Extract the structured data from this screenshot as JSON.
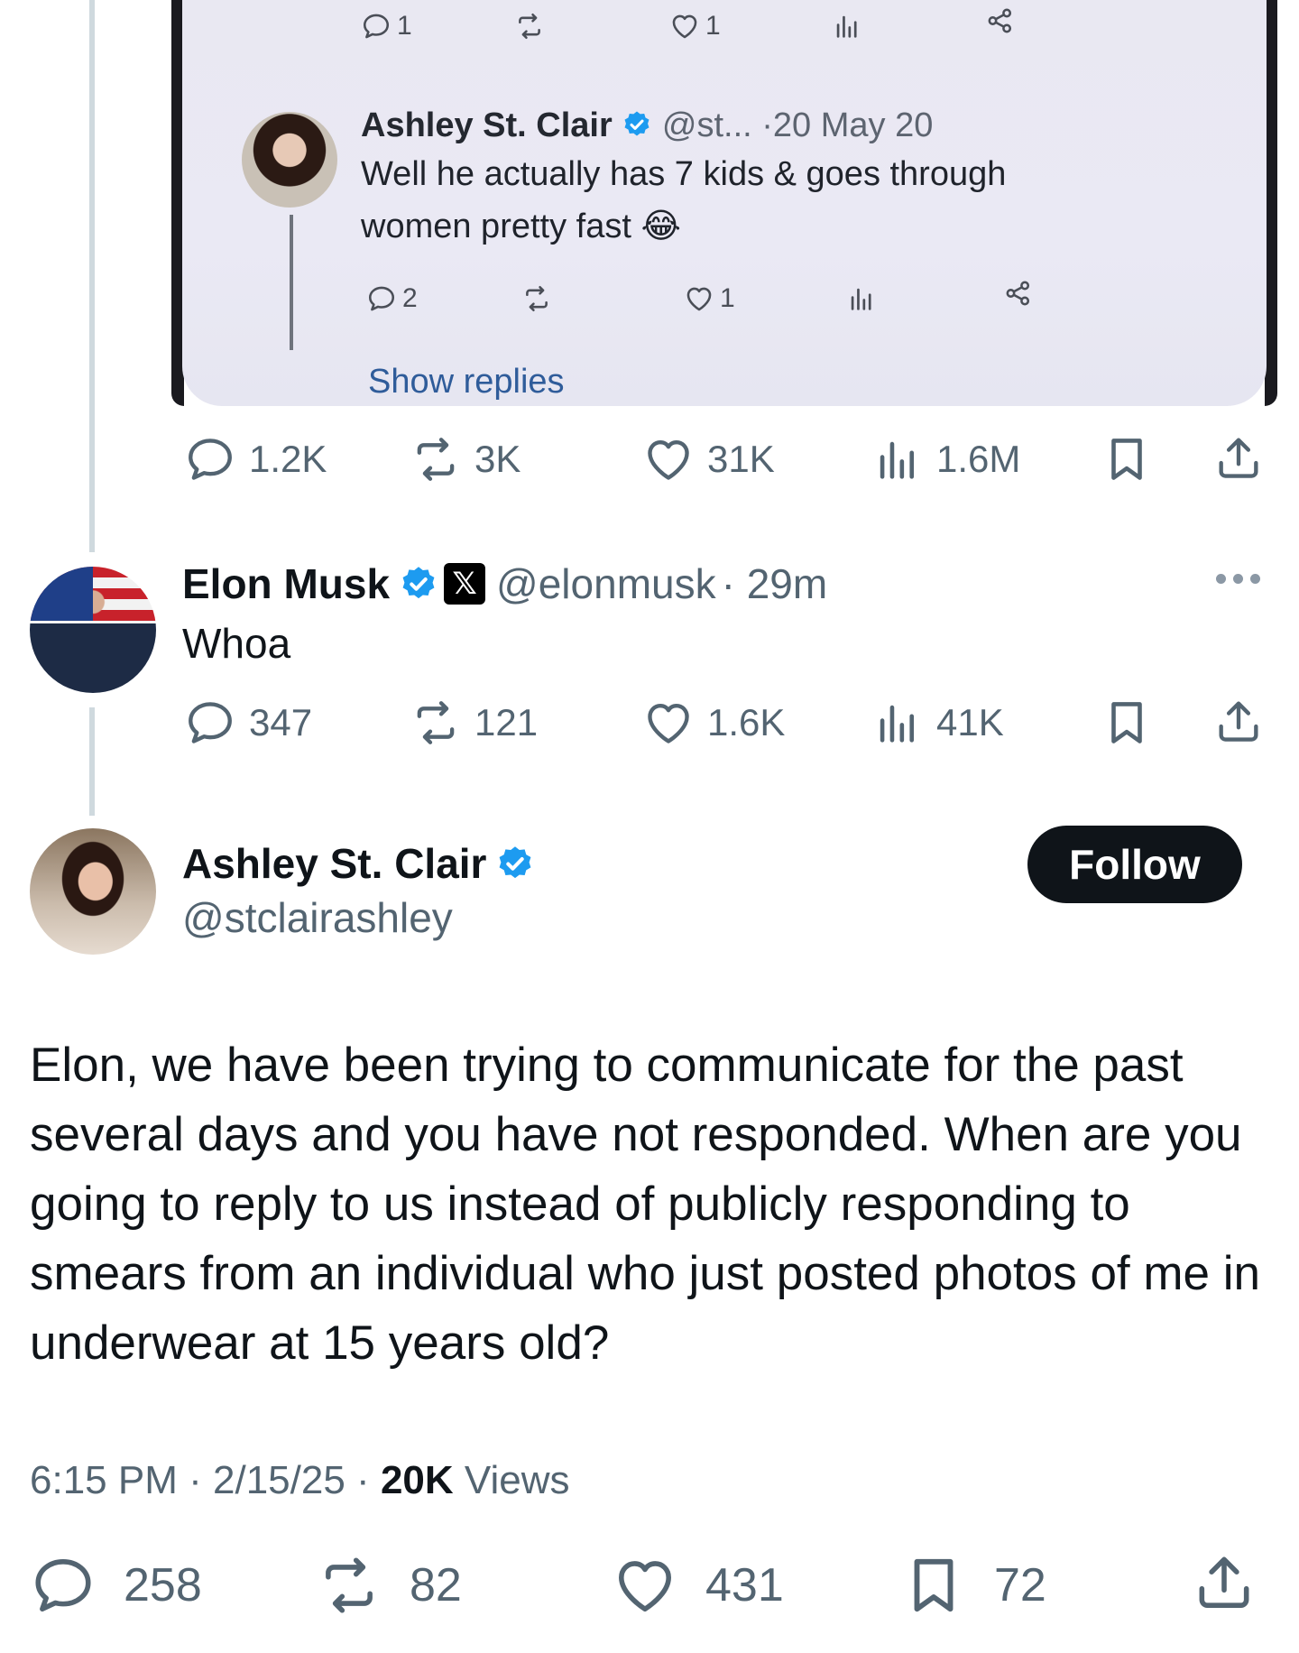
{
  "embedded_screenshot": {
    "top_actions": {
      "replies": "1",
      "likes": "1"
    },
    "reply": {
      "author_name": "Ashley St. Clair",
      "handle": "@st...",
      "date": "·20 May 20",
      "text": "Well he actually has 7 kids & goes through women pretty fast 😂",
      "replies": "2",
      "likes": "1"
    },
    "show_replies_label": "Show replies"
  },
  "parent_tweet_actions": {
    "replies": "1.2K",
    "reposts": "3K",
    "likes": "31K",
    "views": "1.6M"
  },
  "elon_tweet": {
    "author_name": "Elon Musk",
    "x_badge": "𝕏",
    "handle": "@elonmusk",
    "time": "· 29m",
    "text": "Whoa",
    "replies": "347",
    "reposts": "121",
    "likes": "1.6K",
    "views": "41K"
  },
  "main_tweet": {
    "author_name": "Ashley St. Clair",
    "handle": "@stclairashley",
    "follow_label": "Follow",
    "text": "Elon, we have been trying to communicate for the past several days and you have not responded. When are you going to reply to us instead of publicly responding to smears from an individual who just posted photos of me in underwear at 15 years old?",
    "time": "6:15 PM",
    "date": "2/15/25",
    "views_count": "20K",
    "views_label": "Views",
    "replies": "258",
    "reposts": "82",
    "likes": "431",
    "bookmarks": "72"
  },
  "colors": {
    "verified": "#1d9bf0",
    "text": "#0f1419",
    "secondary": "#536471",
    "link": "#2f5c9a"
  }
}
